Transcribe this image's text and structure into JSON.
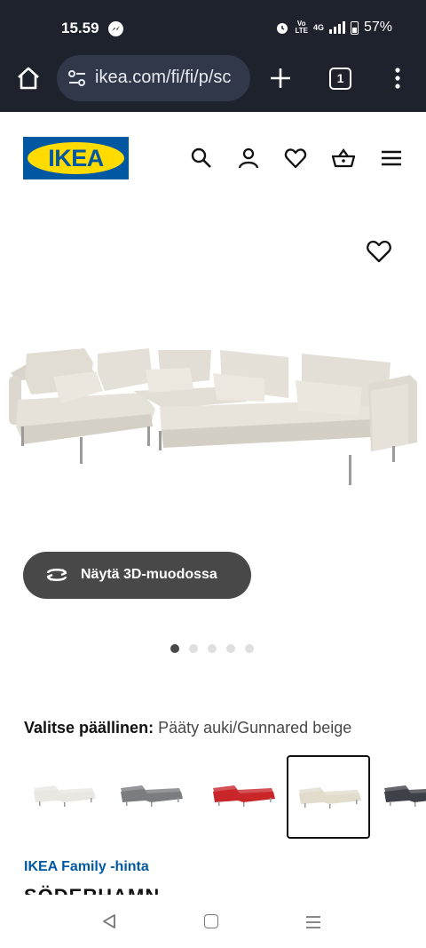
{
  "status_bar": {
    "time": "15.59",
    "volte_line1": "Vo",
    "volte_line2": "LTE",
    "network": "4G",
    "battery": "57%"
  },
  "browser": {
    "url": "ikea.com/fi/fi/p/sc",
    "tab_count": "1"
  },
  "header": {
    "logo_text": "IKEA",
    "icons": [
      "search-icon",
      "user-icon",
      "heart-icon",
      "basket-icon",
      "menu-icon"
    ]
  },
  "product_image": {
    "view_3d_label": "Näytä 3D-muodossa",
    "carousel_total": 5,
    "carousel_active": 1
  },
  "variant": {
    "label": "Valitse päällinen:",
    "value": "Pääty auki/Gunnared beige",
    "swatch_colors": [
      "#e9e7e2",
      "#7a7c80",
      "#c9262a",
      "#e2dccd",
      "#3e4148"
    ],
    "selected_index": 3
  },
  "price": {
    "family_label": "IKEA Family -hinta"
  },
  "product": {
    "name": "SÖDERHAMN"
  },
  "colors": {
    "ikea_blue": "#0058a3",
    "ikea_yellow": "#ffdb00",
    "chrome_bg": "#1d222d"
  }
}
